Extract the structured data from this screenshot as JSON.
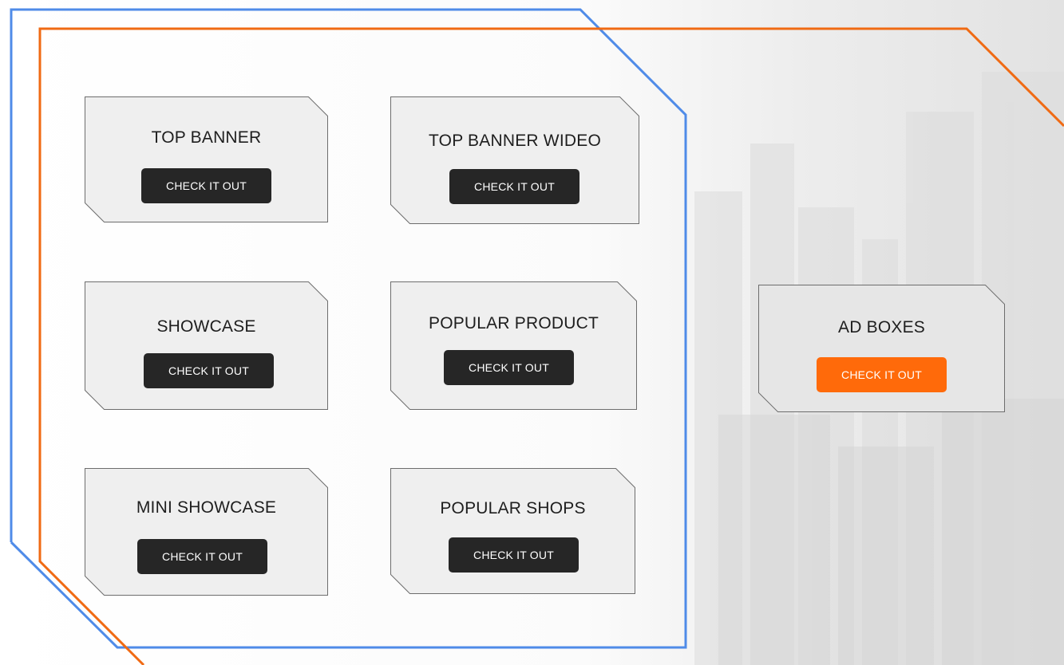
{
  "colors": {
    "blue_frame": "#4f8be8",
    "orange_frame": "#f06a13",
    "card_fill": "#efefef",
    "card_border": "#6d6d6d",
    "button_dark": "#262626",
    "button_accent": "#ff6a0a"
  },
  "cards": [
    {
      "title": "TOP BANNER",
      "button": "CHECK IT OUT"
    },
    {
      "title": "TOP BANNER WIDEO",
      "button": "CHECK IT OUT"
    },
    {
      "title": "SHOWCASE",
      "button": "CHECK IT OUT"
    },
    {
      "title": "POPULAR PRODUCT",
      "button": "CHECK IT OUT"
    },
    {
      "title": "MINI SHOWCASE",
      "button": "CHECK IT OUT"
    },
    {
      "title": "POPULAR SHOPS",
      "button": "CHECK IT OUT"
    }
  ],
  "ad_card": {
    "title": "AD BOXES",
    "button": "CHECK IT OUT"
  }
}
